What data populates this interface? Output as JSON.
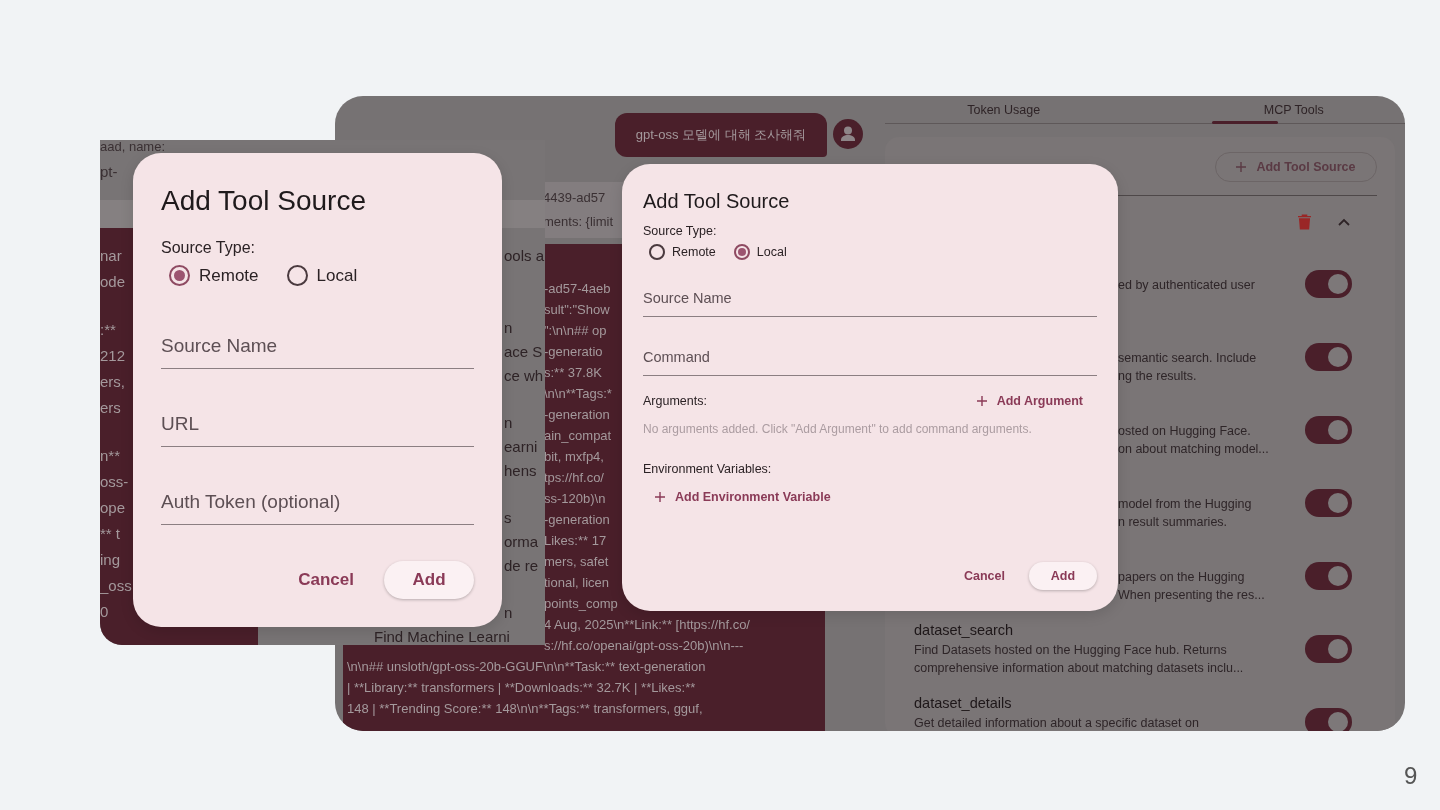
{
  "slide": {
    "page_number": "9"
  },
  "back_screen": {
    "tabs": [
      {
        "label": "Token Usage",
        "selected": false
      },
      {
        "label": "MCP Tools",
        "selected": true
      }
    ],
    "user_message": "gpt-oss 모델에 대해 조사해줘",
    "info_lines": [
      "4439-ad57",
      "ments: {limit"
    ],
    "code_fragments": [
      "-ad57-4aeb",
      "sult\":\"Show",
      "\":\\n\\n## op",
      "-generatio",
      "s:** 37.8K",
      "\\n\\n**Tags:*",
      "-generation",
      "ain_compat",
      "bit, mxfp4,",
      "tps://hf.co/",
      "ss-120b)\\n",
      "-generation",
      "Likes:** 17",
      "mers, safet",
      "tional, licen",
      "points_comp",
      "4 Aug, 2025\\n**Link:** [https://hf.co/",
      "s://hf.co/openai/gpt-oss-20b)\\n\\n---"
    ],
    "code_lines": [
      "\\n\\n## unsloth/gpt-oss-20b-GGUF\\n\\n**Task:** text-generation",
      "| **Library:** transformers | **Downloads:** 32.7K | **Likes:**",
      "148 | **Trending Score:** 148\\n\\n**Tags:** transformers, gguf,"
    ],
    "mcp_panel": {
      "add_button": "Add Tool Source",
      "tools": [
        {
          "kind": "covered",
          "description": [
            "ed by authenticated user"
          ],
          "on": true
        },
        {
          "kind": "covered",
          "description": [
            "semantic search. Include",
            "ng the results."
          ],
          "on": true
        },
        {
          "kind": "covered",
          "description": [
            "osted on Hugging Face.",
            "on about matching model..."
          ],
          "on": true
        },
        {
          "kind": "covered",
          "description": [
            "model from the Hugging",
            "n result summaries."
          ],
          "on": true
        },
        {
          "kind": "covered",
          "description": [
            "papers on the Hugging",
            "When presenting the res..."
          ],
          "on": true
        },
        {
          "kind": "full",
          "title": "dataset_search",
          "description": [
            "Find Datasets hosted on the Hugging Face hub. Returns",
            "comprehensive information about matching datasets inclu..."
          ],
          "on": true
        },
        {
          "kind": "full",
          "title": "dataset_details",
          "description": [
            "Get detailed information about a specific dataset on"
          ],
          "on": true
        }
      ]
    }
  },
  "left_screen": {
    "top_fragments": [
      "aad, name:",
      "pt-"
    ],
    "code_groups": [
      [
        "nar",
        "ode"
      ],
      [
        ":**",
        "212",
        "ers,",
        "ers"
      ],
      [
        "n**",
        "oss-",
        "ope",
        "** t",
        "ing",
        "_oss",
        "0"
      ]
    ],
    "side_groups": [
      [
        "ools a"
      ],
      [
        "n",
        "ace S",
        "ce wh"
      ],
      [
        "n",
        "earni",
        "hens"
      ],
      [
        "s",
        "orma",
        "de re"
      ],
      [
        "n"
      ]
    ],
    "bottom_fragment": "Find Machine Learni"
  },
  "dialogs": [
    {
      "kind": "remote",
      "title": "Add Tool Source",
      "source_type_label": "Source Type:",
      "options": [
        {
          "label": "Remote",
          "selected": true
        },
        {
          "label": "Local",
          "selected": false
        }
      ],
      "fields": [
        {
          "placeholder": "Source Name"
        },
        {
          "placeholder": "URL"
        },
        {
          "placeholder": "Auth Token (optional)"
        }
      ],
      "buttons": [
        "Cancel",
        "Add"
      ]
    },
    {
      "kind": "local",
      "title": "Add Tool Source",
      "source_type_label": "Source Type:",
      "options": [
        {
          "label": "Remote",
          "selected": false
        },
        {
          "label": "Local",
          "selected": true
        }
      ],
      "fields": [
        {
          "placeholder": "Source Name"
        },
        {
          "placeholder": "Command"
        }
      ],
      "arguments": {
        "label": "Arguments:",
        "add_button": "Add Argument",
        "empty_text": "No arguments added. Click \"Add Argument\" to add command arguments."
      },
      "environment": {
        "label": "Environment Variables:",
        "add_button": "Add Environment Variable"
      },
      "buttons": [
        "Cancel",
        "Add"
      ]
    }
  ]
}
